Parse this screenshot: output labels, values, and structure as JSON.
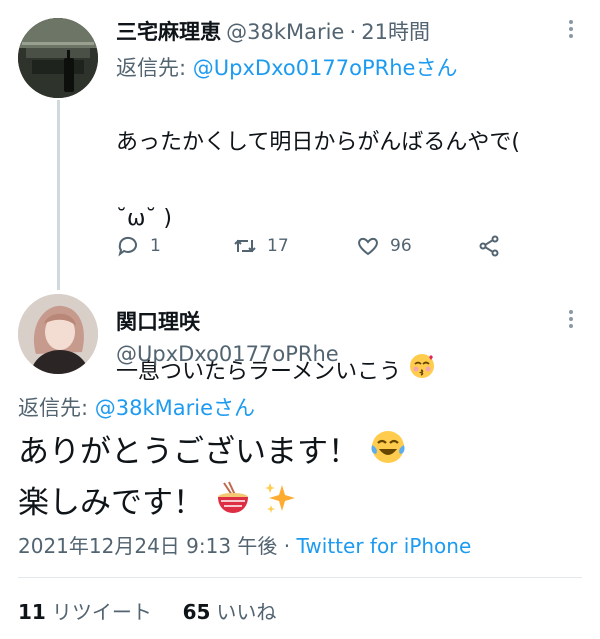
{
  "tweet1": {
    "name": "三宅麻理恵",
    "handle": "@38kMarie",
    "separator": "·",
    "time": "21時間",
    "reply_prefix": "返信先:",
    "reply_to": "@UpxDxo0177oPRheさん",
    "text_line1": "あったかくして明日からがんばるんやで(",
    "text_line2": "˘ω˘ )",
    "text_line3": "一息ついたらラーメンいこう",
    "replies": "1",
    "retweets": "17",
    "likes": "96"
  },
  "tweet2": {
    "name": "関口理咲",
    "handle": "@UpxDxo0177oPRhe",
    "reply_prefix": "返信先:",
    "reply_to": "@38kMarieさん",
    "text_line1": "ありがとうございます！",
    "text_line2": "楽しみです！",
    "timestamp": "2021年12月24日 9:13 午後",
    "separator": "·",
    "source": "Twitter for iPhone",
    "retweet_count": "11",
    "retweet_label": "リツイート",
    "like_count": "65",
    "like_label": "いいね"
  },
  "icons": {
    "reply": "reply-icon",
    "retweet": "retweet-icon",
    "like": "heart-icon",
    "share": "share-icon",
    "more": "more-icon"
  },
  "colors": {
    "link": "#1d9bf0",
    "muted": "#536471",
    "text": "#0f1419"
  }
}
